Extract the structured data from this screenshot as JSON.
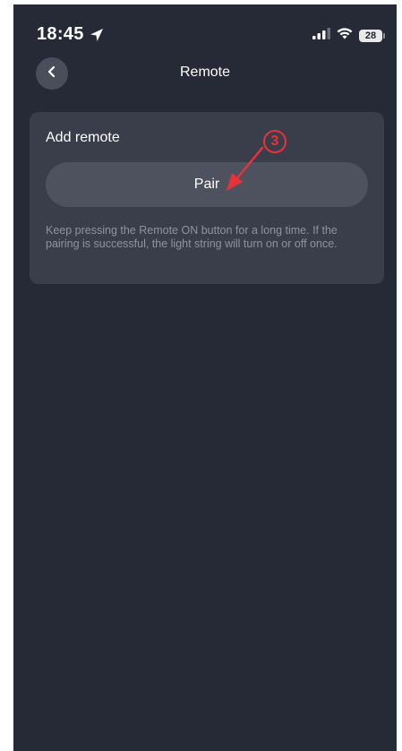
{
  "status_bar": {
    "time": "18:45",
    "battery": "28",
    "icons": [
      "location-arrow-icon",
      "cellular-signal-icon",
      "wifi-icon",
      "battery-icon"
    ]
  },
  "nav": {
    "title": "Remote",
    "back_icon": "chevron-left-icon"
  },
  "card": {
    "title": "Add remote",
    "pair_button": "Pair",
    "help_text": "Keep pressing the Remote ON button for a long time. If the pairing is successful, the light string will turn on or off once."
  },
  "annotation": {
    "step": "3",
    "color": "#e8323a"
  },
  "colors": {
    "background": "#262a36",
    "card": "#3a3e4b",
    "button": "#4e525e"
  }
}
